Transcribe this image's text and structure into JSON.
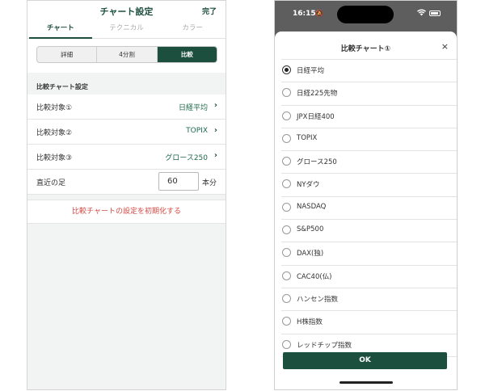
{
  "left": {
    "header": {
      "title": "チャート設定",
      "done": "完了"
    },
    "tabs": [
      "チャート",
      "テクニカル",
      "カラー"
    ],
    "segments": [
      "詳細",
      "4分割",
      "比較"
    ],
    "section_title": "比較チャート設定",
    "rows": [
      {
        "label": "比較対象①",
        "value": "日経平均"
      },
      {
        "label": "比較対象②",
        "value": "TOPIX"
      },
      {
        "label": "比較対象③",
        "value": "グロース250"
      }
    ],
    "recent": {
      "label": "直近の足",
      "value": "60",
      "unit": "本分"
    },
    "reset": "比較チャートの設定を初期化する",
    "accent": "#1d4f3f",
    "reset_color": "#d34a43"
  },
  "right": {
    "status": {
      "time": "16:15"
    },
    "sheet": {
      "title": "比較チャート①",
      "close": "×",
      "options": [
        "日経平均",
        "日経225先物",
        "JPX日経400",
        "TOPIX",
        "グロース250",
        "NYダウ",
        "NASDAQ",
        "S&P500",
        "DAX(独)",
        "CAC40(仏)",
        "ハンセン指数",
        "H株指数",
        "レッドチップ指数"
      ],
      "selected_index": 0,
      "ok": "OK"
    }
  }
}
